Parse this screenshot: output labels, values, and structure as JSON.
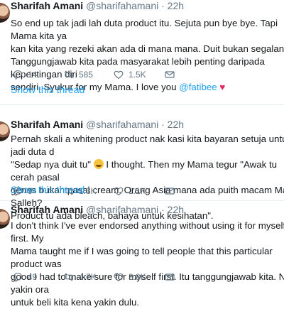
{
  "tweets": [
    {
      "name": "Sharifah Amani",
      "handle": "@sharifahamani",
      "dot": "·",
      "time": "22h",
      "text_before": "So end up tak jadi lah duta product itu. Sejuta pun bye bye. Tapi Mama kita ya\nkan kita yang rezeki akan ada di mana mana. Duit bukan segalanya.\nTanggungjawab kita pada masyarakat lebih penting daripada kepentingan diri\nsendiri. Syukur for my Mama. I love you ",
      "mention": "@fatibee",
      "emoji": "heart-icon",
      "stats": {
        "replies": "14",
        "retweets": "585",
        "likes": "1.5K"
      },
      "show_thread": "Show this thread"
    },
    {
      "name": "Sharifah Amani",
      "handle": "@sharifahamani",
      "dot": "·",
      "time": "22h",
      "text_before": "Pernah skali a whitening product nak kasi kita bayaran setuja untuk jadi duta d\n\"Sedap nya duit tu\" ",
      "text_after": " I thought. Then my Mama tegur \"Awak tu cerah pasal\ngenes bukan pasal cream. Orang Asia mana ada puith macam Mat Salleh?\nProduct tu ada bleach, bahaya untuk kesihatan\".",
      "emoji": "money-mouth-face-icon",
      "stats": {
        "replies": "9",
        "retweets": "1.3K",
        "likes": "1.1K"
      },
      "show_thread": "Show this thread"
    },
    {
      "name": "Sharifah Amani",
      "handle": "@sharifahamani",
      "dot": "·",
      "time": "22h",
      "text_before": "I don't think I've ever endorsed anything without using it for myself first. My\nMama taught me if I was going to tell people that this particular product was\ngood I had to make sure for myself first. Itu tanggungjawab kita. Nak yakin ora\nuntuk beli kita kena yakin dulu.",
      "stats": {
        "replies": "49",
        "retweets": "4.7K",
        "likes": "3.8K"
      }
    }
  ],
  "colors": {
    "accent": "#1da1f2",
    "text": "#14171a",
    "muted": "#657786",
    "heart": "#e0245e",
    "divider": "#e6ecf0"
  }
}
